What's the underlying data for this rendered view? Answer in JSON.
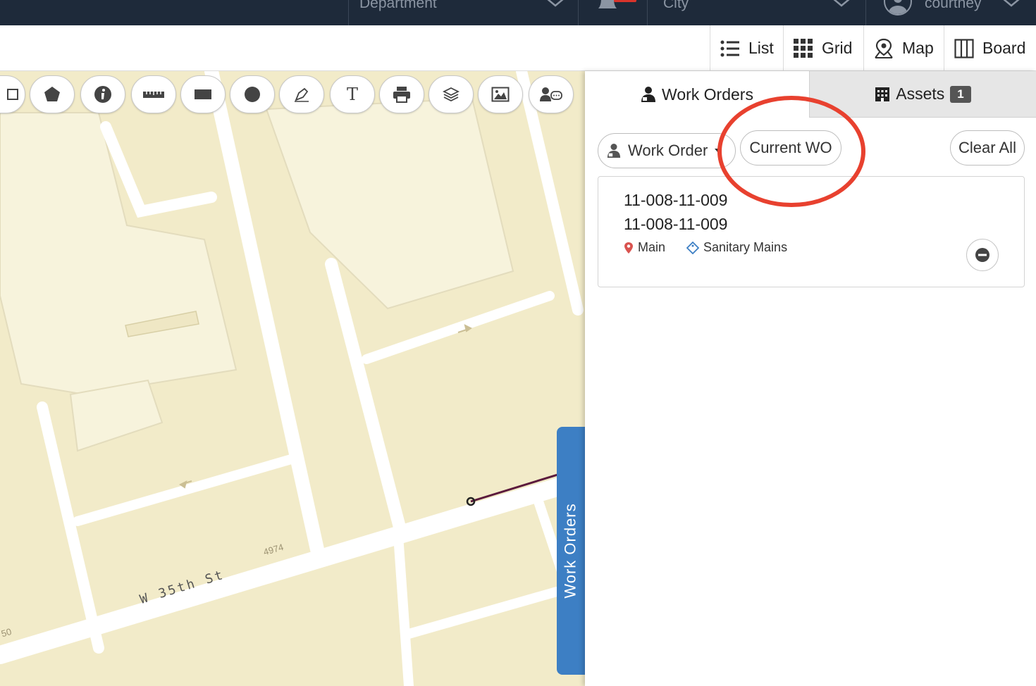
{
  "topbar": {
    "department_label": "Department",
    "city_label": "City",
    "user_name": "courtney"
  },
  "views": [
    {
      "label": "List",
      "icon": "list-icon"
    },
    {
      "label": "Grid",
      "icon": "grid-icon"
    },
    {
      "label": "Map",
      "icon": "map-pin-icon"
    },
    {
      "label": "Board",
      "icon": "board-icon"
    }
  ],
  "map": {
    "street_label": "W 35th St",
    "address_label_1": "4974",
    "address_label_2": "50",
    "side_tab_label": "Work Orders",
    "tools": [
      "rectangle-select-icon",
      "polygon-icon",
      "info-icon",
      "ruler-icon",
      "rectangle-icon",
      "circle-icon",
      "draw-icon",
      "text-icon",
      "print-icon",
      "layers-icon",
      "image-icon",
      "user-comment-icon"
    ]
  },
  "panel": {
    "tab_work_orders": "Work Orders",
    "tab_assets": "Assets",
    "assets_count": "1",
    "filter_label": "Work Order",
    "current_wo_label": "Current WO",
    "clear_all_label": "Clear All",
    "item": {
      "id_line1": "11-008-11-009",
      "id_line2": "11-008-11-009",
      "location": "Main",
      "asset_type": "Sanitary Mains"
    }
  },
  "colors": {
    "topbar": "#1e2a3a",
    "map_background": "#f2ebc9",
    "side_tab": "#3d7fc4",
    "annotation": "#e8412f"
  }
}
